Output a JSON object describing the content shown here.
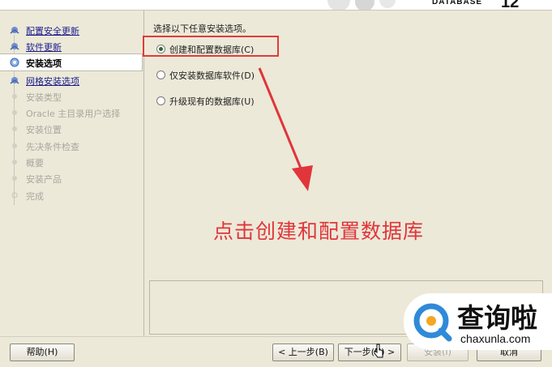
{
  "header": {
    "brand": "DATABASE",
    "version": "12"
  },
  "sidebar": {
    "steps": [
      {
        "label": "配置安全更新",
        "state": "done"
      },
      {
        "label": "软件更新",
        "state": "done"
      },
      {
        "label": "安装选项",
        "state": "current"
      },
      {
        "label": "网格安装选项",
        "state": "done"
      },
      {
        "label": "安装类型",
        "state": "future"
      },
      {
        "label": "Oracle 主目录用户选择",
        "state": "future"
      },
      {
        "label": "安装位置",
        "state": "future"
      },
      {
        "label": "先决条件检查",
        "state": "future"
      },
      {
        "label": "概要",
        "state": "future"
      },
      {
        "label": "安装产品",
        "state": "future"
      },
      {
        "label": "完成",
        "state": "future"
      }
    ]
  },
  "main": {
    "instruction": "选择以下任意安装选项。",
    "options": [
      {
        "label": "创建和配置数据库(C)",
        "selected": true
      },
      {
        "label": "仅安装数据库软件(D)",
        "selected": false
      },
      {
        "label": "升级现有的数据库(U)",
        "selected": false
      }
    ],
    "annotation": "点击创建和配置数据库",
    "annotation_color": "#e0353b"
  },
  "footer": {
    "help": "帮助(H)",
    "back": "< 上一步(B)",
    "next": "下一步(N) >",
    "install": "安装(I)",
    "cancel": "取消"
  },
  "watermark": {
    "title": "查询啦",
    "url": "chaxunla.com",
    "accent": "#2f8ad8",
    "accent2": "#f5a623"
  }
}
